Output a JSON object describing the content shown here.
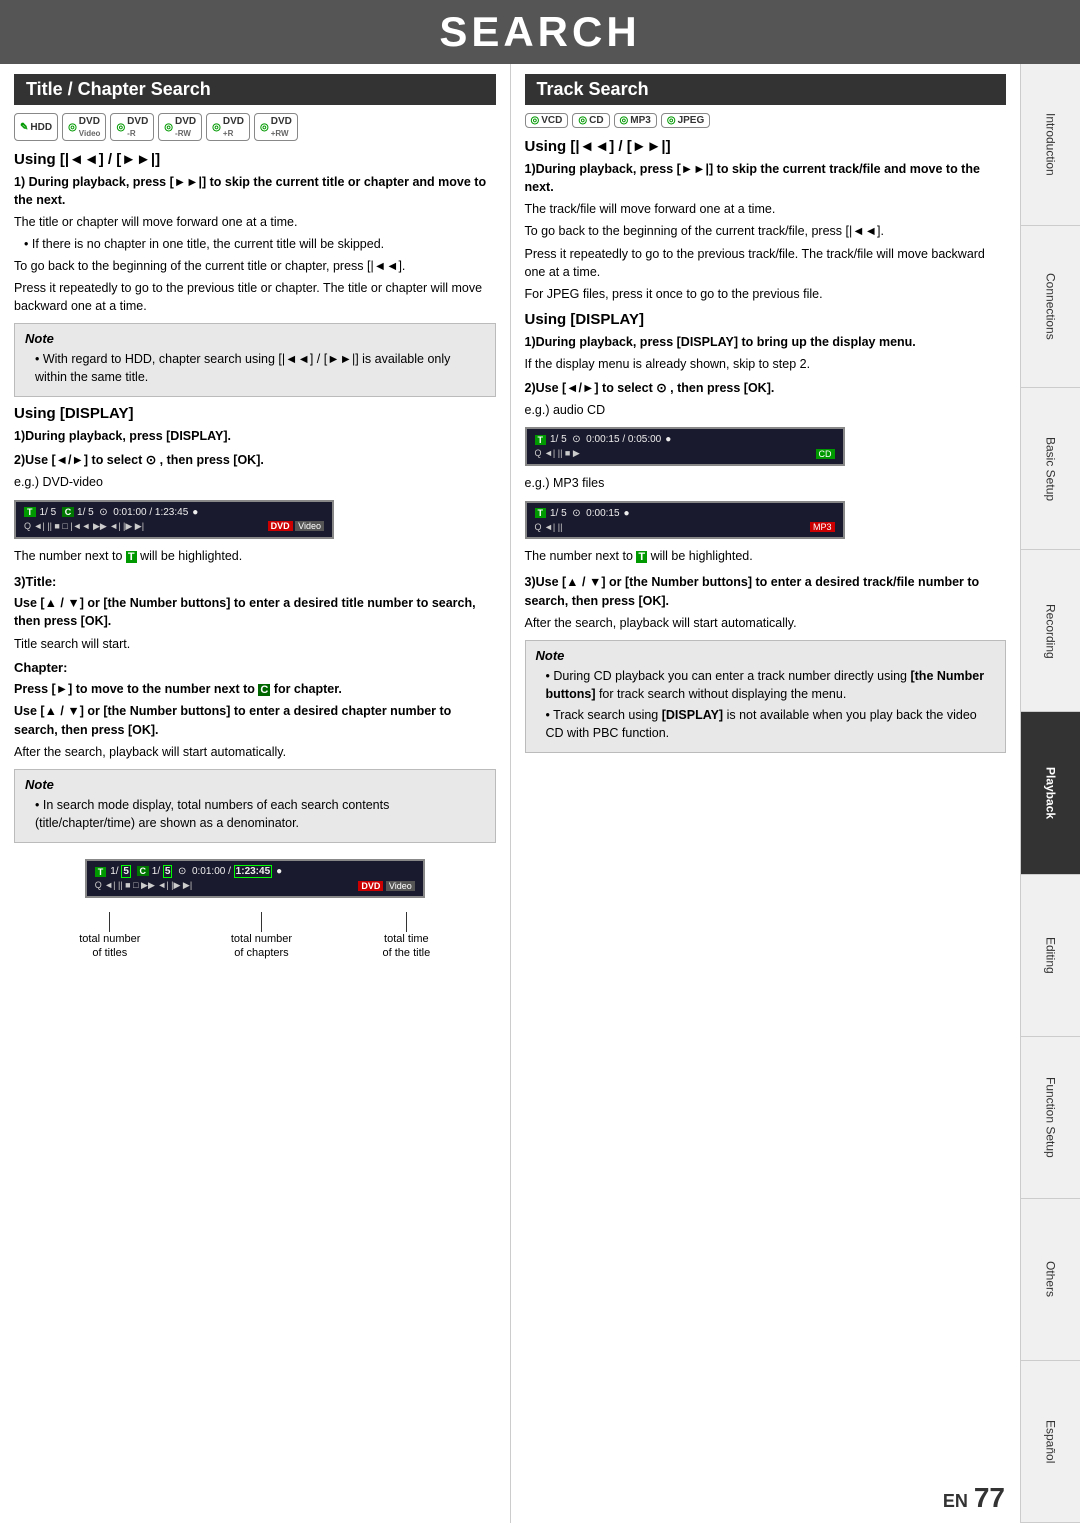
{
  "header": {
    "title": "SEARCH"
  },
  "left_section": {
    "title": "Title / Chapter Search",
    "formats": [
      "HDD",
      "DVD Video",
      "DVD -R",
      "DVD -RW",
      "DVD +R",
      "DVD +RW"
    ],
    "sub1": {
      "heading": "Using [|◄◄] / [►►|]",
      "step1_label": "1) During playback, press [►►|] to skip the current title or chapter and move to the next.",
      "step1_body": [
        "The title or chapter will move forward one at a time.",
        "• If there is no chapter in one title, the current title will be skipped.",
        "To go back to the beginning of the current title or chapter, press [|◄◄].",
        "Press it repeatedly to go to the previous title or chapter. The title or chapter will move backward one at a time."
      ]
    },
    "note1": {
      "title": "Note",
      "items": [
        "With regard to HDD, chapter search using [|◄◄] / [►►|] is available only within the same title."
      ]
    },
    "sub2": {
      "heading": "Using [DISPLAY]",
      "step1_label": "1) During playback, press [DISPLAY].",
      "step2_label": "2) Use [◄/►] to select",
      "step2_suffix": ", then press [OK].",
      "step2_eg": "e.g.) DVD-video",
      "screen1": {
        "t": "T",
        "vals": "1/ 5  C  1/ 5  ⊙  0:01:00 / 1:23:45",
        "icons": "Q ◄ || ■ □ |◄◄ ►► ◄| |► ►|",
        "badge1": "DVD",
        "badge2": "Video"
      },
      "highlight_note": "The number next to",
      "highlight_icon": "T",
      "highlight_suffix": "will be highlighted.",
      "step3_label": "3) Title:",
      "step3_body_title": "Use [▲ / ▼] or [the Number buttons] to enter a desired title number to search, then press [OK].",
      "step3_title_sub": "Title search will start.",
      "step3_chapter_label": "Chapter:",
      "step3_chapter_body": "Press [►] to move to the number next to",
      "step3_chapter_c": "C",
      "step3_chapter_body2": "for chapter.",
      "step3_chapter_body3": "Use [▲ / ▼] or [the Number buttons] to enter a desired chapter number to search, then press [OK].",
      "step3_chapter_auto": "After the search, playback will start automatically."
    },
    "note2": {
      "title": "Note",
      "items": [
        "In search mode display, total numbers of each search contents (title/chapter/time) are shown as a denominator."
      ]
    },
    "diagram": {
      "screen": {
        "t": "T",
        "vals": "1/ 5  C  1/ 5  ⊙  0:01:00 / 1:23:45",
        "icons": "Q ◄ || ■ □ ►► ◄| |► ►|",
        "badge1": "DVD",
        "badge2": "Video"
      },
      "labels": [
        {
          "text": "total number\nof titles",
          "position": "left"
        },
        {
          "text": "total number\nof chapters",
          "position": "center"
        },
        {
          "text": "total time\nof the title",
          "position": "right"
        }
      ]
    }
  },
  "right_section": {
    "title": "Track Search",
    "formats": [
      "VCD",
      "CD",
      "MP3",
      "JPEG"
    ],
    "sub1": {
      "heading": "Using [|◄◄] / [►►|]",
      "step1_label": "1) During playback, press [►►|] to skip the current track/file and move to the next.",
      "step1_body": [
        "The track/file will move forward one at a time.",
        "To go back to the beginning of the current track/file, press [|◄◄].",
        "Press it repeatedly to go to the previous track/file. The track/file will move backward one at a time.",
        "For JPEG files, press it once to go to the previous file."
      ]
    },
    "sub2": {
      "heading": "Using [DISPLAY]",
      "step1_label": "1) During playback, press [DISPLAY] to bring up the display menu.",
      "step1_sub": "If the display menu is already shown, skip to step 2.",
      "step2_label": "2) Use [◄/►] to select",
      "step2_suffix": ", then press [OK].",
      "step2_eg": "e.g.) audio CD",
      "screen_cd": {
        "t": "T",
        "vals": "1/ 5  ⊙  0:00:15 / 0:05:00",
        "icons": "Q ◄ || ■ ►",
        "badge": "CD"
      },
      "step2_eg2": "e.g.) MP3 files",
      "screen_mp3": {
        "t": "T",
        "vals": "1/ 5  ⊙  0:00:15",
        "icons": "Q ◄ ||",
        "badge": "MP3"
      },
      "highlight_note": "The number next to",
      "highlight_icon": "T",
      "highlight_suffix": "will be highlighted.",
      "step3_label": "3) Use [▲ / ▼] or [the Number buttons] to enter a desired track/file number to search, then press [OK].",
      "step3_body": "After the search, playback will start automatically."
    },
    "note": {
      "title": "Note",
      "items": [
        "During CD playback you can enter a track number directly using [the Number buttons] for track search without displaying the menu.",
        "Track search using [DISPLAY] is not available when you play back the video CD with PBC function."
      ]
    }
  },
  "sidebar": {
    "tabs": [
      {
        "label": "Introduction",
        "active": false
      },
      {
        "label": "Connections",
        "active": false
      },
      {
        "label": "Basic Setup",
        "active": false
      },
      {
        "label": "Recording",
        "active": false
      },
      {
        "label": "Playback",
        "active": true
      },
      {
        "label": "Editing",
        "active": false
      },
      {
        "label": "Function Setup",
        "active": false
      },
      {
        "label": "Others",
        "active": false
      },
      {
        "label": "Español",
        "active": false
      }
    ]
  },
  "footer": {
    "en_label": "EN",
    "page_number": "77"
  }
}
